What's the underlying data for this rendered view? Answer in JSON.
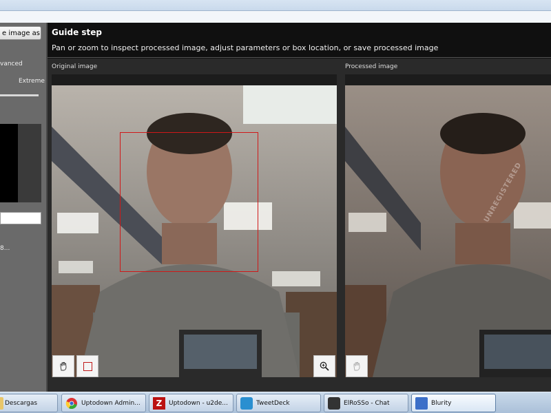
{
  "sidebar": {
    "save_button_label": "e image as...",
    "option_advanced": "vanced",
    "option_extreme": "Extreme",
    "value_text": "8..."
  },
  "header": {
    "title": "Guide step",
    "description": "Pan or zoom to inspect processed image, adjust parameters or box location, or save processed image"
  },
  "panels": {
    "original_label": "Original image",
    "processed_label": "Processed image",
    "watermark": "UNREGISTERED"
  },
  "taskbar": {
    "items": [
      {
        "label": "Descargas"
      },
      {
        "label": "Uptodown Admin..."
      },
      {
        "label": "Uptodown - u2de..."
      },
      {
        "label": "TweetDeck"
      },
      {
        "label": "ElRoSSo - Chat"
      },
      {
        "label": "Blurity"
      }
    ]
  },
  "colors": {
    "selection_box": "#d01818",
    "panel_bg": "#2a2a2a"
  }
}
